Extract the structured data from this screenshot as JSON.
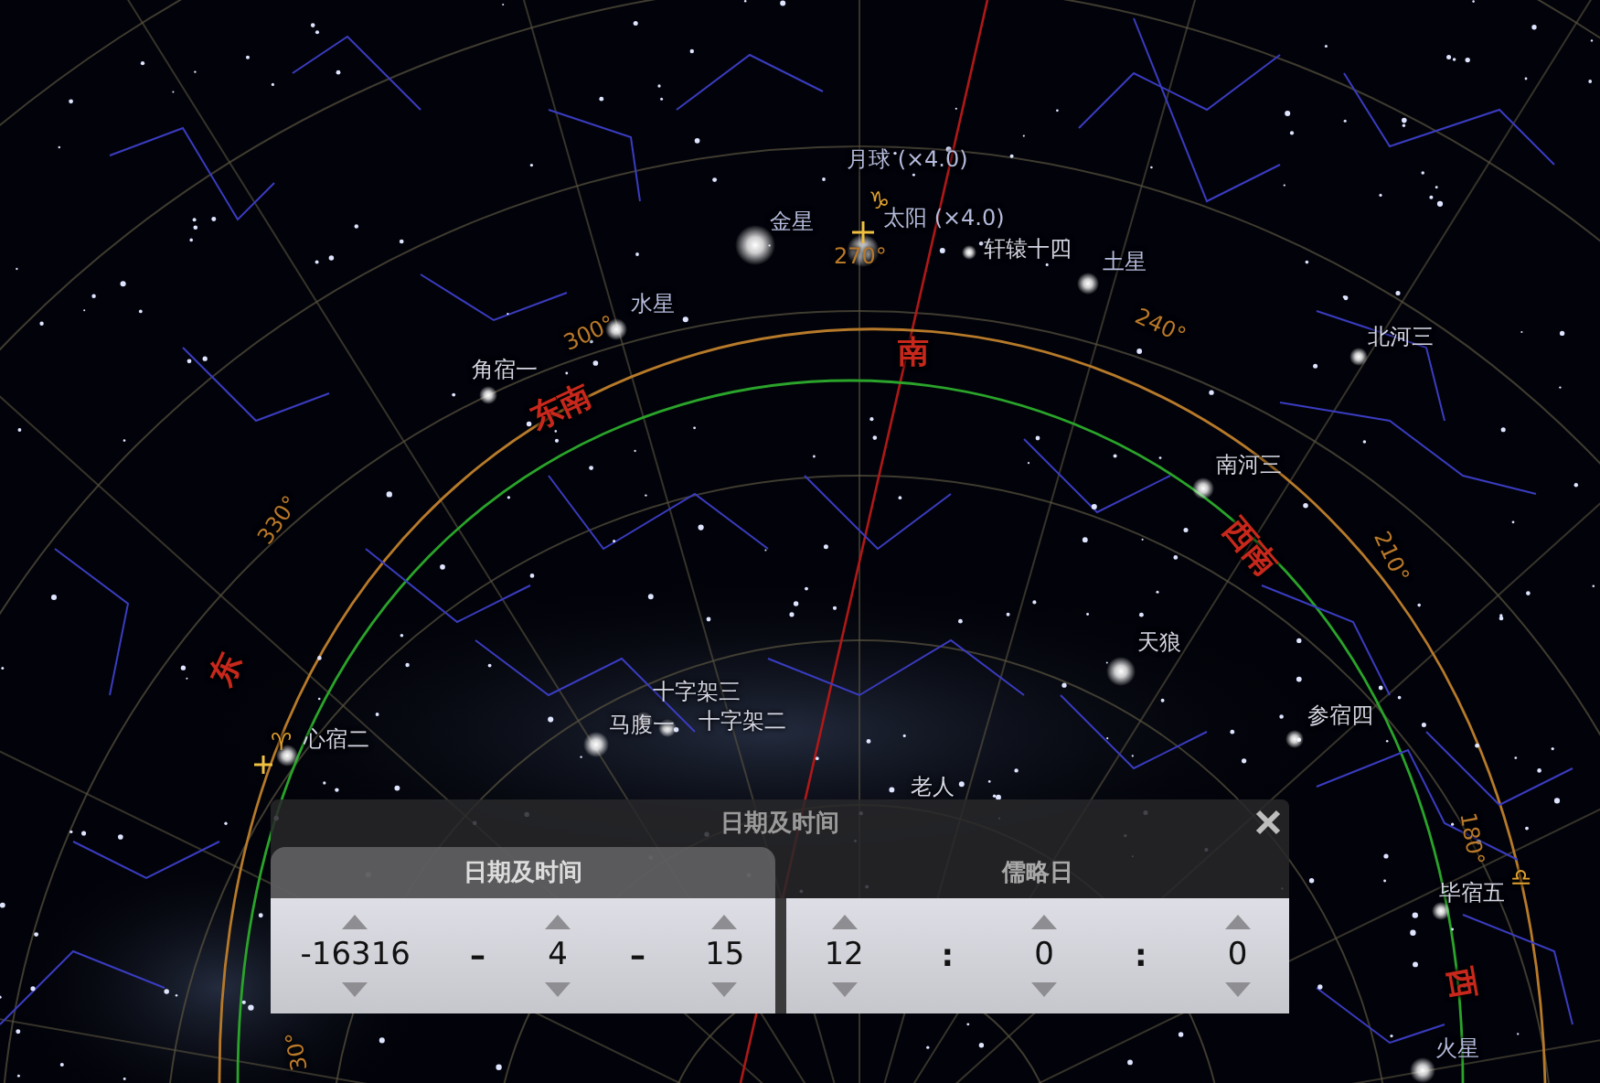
{
  "sky_labels": [
    {
      "kind": "planet",
      "text": "月球 (×4.0)"
    },
    {
      "kind": "symbol",
      "text": "♑"
    },
    {
      "kind": "planet",
      "text": "金星"
    },
    {
      "kind": "planet",
      "text": "太阳 (×4.0)"
    },
    {
      "kind": "star",
      "text": "轩辕十四"
    },
    {
      "kind": "planet",
      "text": "土星"
    },
    {
      "kind": "planet",
      "text": "水星"
    },
    {
      "kind": "star",
      "text": "角宿一"
    },
    {
      "kind": "star",
      "text": "北河三"
    },
    {
      "kind": "star",
      "text": "南河三"
    },
    {
      "kind": "star",
      "text": "天狼"
    },
    {
      "kind": "star",
      "text": "参宿四"
    },
    {
      "kind": "star",
      "text": "十字架三"
    },
    {
      "kind": "star",
      "text": "马腹一"
    },
    {
      "kind": "star",
      "text": "十字架二"
    },
    {
      "kind": "star",
      "text": "心宿二"
    },
    {
      "kind": "star",
      "text": "老人"
    },
    {
      "kind": "star",
      "text": "毕宿五"
    },
    {
      "kind": "planet",
      "text": "火星"
    },
    {
      "kind": "cardinal",
      "text": "南"
    },
    {
      "kind": "cardinal",
      "text": "东南"
    },
    {
      "kind": "cardinal",
      "text": "西南"
    },
    {
      "kind": "cardinal",
      "text": "东"
    },
    {
      "kind": "cardinal",
      "text": "西"
    },
    {
      "kind": "degree",
      "text": "300°"
    },
    {
      "kind": "degree",
      "text": "270°"
    },
    {
      "kind": "degree",
      "text": "240°"
    },
    {
      "kind": "degree",
      "text": "210°"
    },
    {
      "kind": "degree",
      "text": "330°"
    },
    {
      "kind": "degree",
      "text": "180°"
    },
    {
      "kind": "degree",
      "text": "30°"
    },
    {
      "kind": "symbol",
      "text": "♈"
    },
    {
      "kind": "symbol",
      "text": "♎"
    }
  ],
  "dialog": {
    "title": "日期及时间",
    "tabs": [
      {
        "label": "日期及时间",
        "selected": true
      },
      {
        "label": "儒略日",
        "selected": false
      }
    ],
    "panels": [
      {
        "items": [
          {
            "kind": "field",
            "value": "-16316"
          },
          {
            "kind": "separator",
            "text": "–"
          },
          {
            "kind": "field",
            "value": "4"
          },
          {
            "kind": "separator",
            "text": "–"
          },
          {
            "kind": "field",
            "value": "15"
          }
        ]
      },
      {
        "items": [
          {
            "kind": "field",
            "value": "12"
          },
          {
            "kind": "separator",
            "text": ":"
          },
          {
            "kind": "field",
            "value": "0"
          },
          {
            "kind": "separator",
            "text": ":"
          },
          {
            "kind": "field",
            "value": "0"
          }
        ]
      }
    ]
  }
}
